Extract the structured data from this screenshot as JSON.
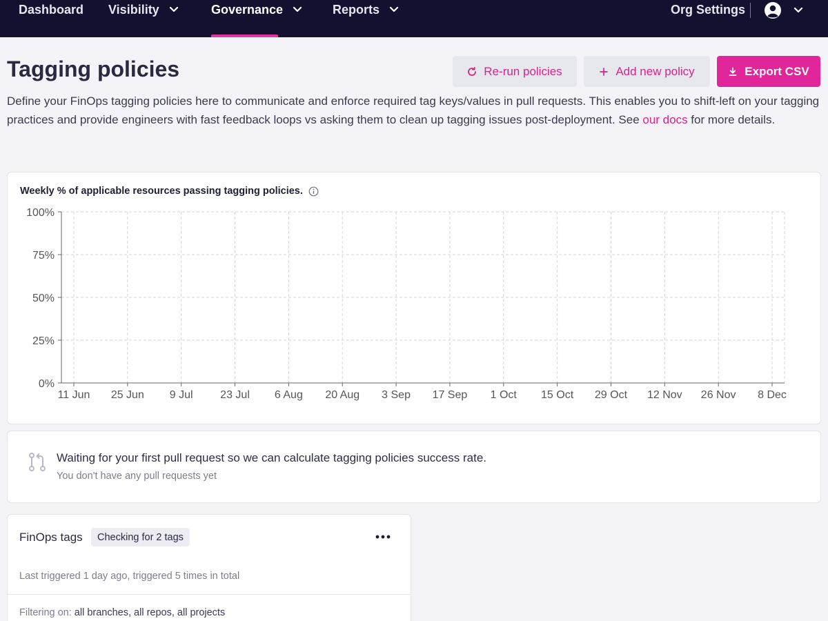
{
  "nav": {
    "items": [
      {
        "label": "Dashboard",
        "has_dropdown": false,
        "active": false
      },
      {
        "label": "Visibility",
        "has_dropdown": true,
        "active": false
      },
      {
        "label": "Governance",
        "has_dropdown": true,
        "active": true
      },
      {
        "label": "Reports",
        "has_dropdown": true,
        "active": false
      }
    ],
    "org_settings": "Org Settings",
    "user_icon": "user-circle-icon",
    "accent_color": "#e0359b"
  },
  "header": {
    "title": "Tagging policies",
    "buttons": {
      "rerun": "Re-run policies",
      "add": "Add new policy",
      "export": "Export CSV"
    },
    "description_before_link": "Define your FinOps tagging policies here to communicate and enforce required tag keys/values in pull requests. This enables you to shift-left on your tagging practices and provide engineers with fast feedback loops vs asking them to clean up tagging issues post-deployment. See ",
    "description_link": "our docs",
    "description_after_link": " for more details."
  },
  "chart_data": {
    "type": "line",
    "title": "Weekly % of applicable resources passing tagging policies.",
    "categories": [
      "11 Jun",
      "25 Jun",
      "9 Jul",
      "23 Jul",
      "6 Aug",
      "20 Aug",
      "3 Sep",
      "17 Sep",
      "1 Oct",
      "15 Oct",
      "29 Oct",
      "12 Nov",
      "26 Nov",
      "8 Dec"
    ],
    "y_ticks": [
      "0%",
      "25%",
      "50%",
      "75%",
      "100%"
    ],
    "ylim": [
      0,
      100
    ],
    "series": [],
    "grid": true
  },
  "waiting": {
    "message": "Waiting for your first pull request so we can calculate tagging policies success rate.",
    "sub": "You don't have any pull requests yet"
  },
  "policy": {
    "name": "FinOps tags",
    "badge": "Checking for 2 tags",
    "trigger": "Last triggered 1 day ago, triggered 5 times in total",
    "filter_label": "Filtering on:",
    "filter_value": "all branches, all repos, all projects"
  }
}
